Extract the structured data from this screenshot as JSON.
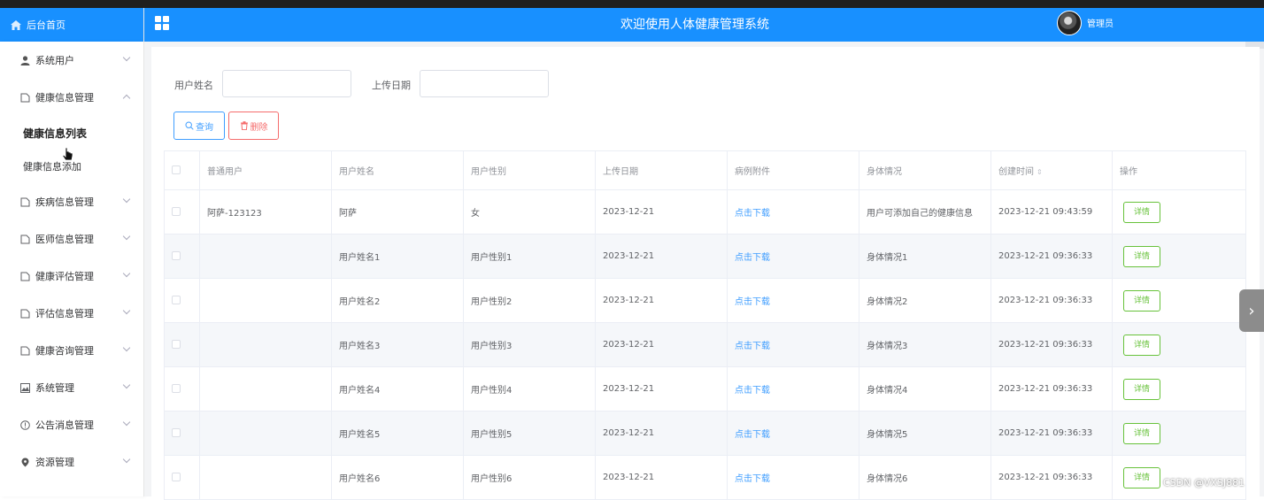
{
  "header": {
    "home_label": "后台首页",
    "title": "欢迎使用人体健康管理系统",
    "user_label": "管理员"
  },
  "sidebar": {
    "items": [
      {
        "label": "系统用户",
        "icon": "user-icon"
      },
      {
        "label": "健康信息管理",
        "icon": "document-icon",
        "expanded": true,
        "children": [
          {
            "label": "健康信息列表",
            "active": true
          },
          {
            "label": "健康信息添加"
          }
        ]
      },
      {
        "label": "疾病信息管理",
        "icon": "document-icon"
      },
      {
        "label": "医师信息管理",
        "icon": "document-icon"
      },
      {
        "label": "健康评估管理",
        "icon": "document-icon"
      },
      {
        "label": "评估信息管理",
        "icon": "document-icon"
      },
      {
        "label": "健康咨询管理",
        "icon": "document-icon"
      },
      {
        "label": "系统管理",
        "icon": "picture-icon"
      },
      {
        "label": "公告消息管理",
        "icon": "info-circle-icon"
      },
      {
        "label": "资源管理",
        "icon": "location-icon"
      }
    ]
  },
  "search": {
    "username_label": "用户姓名",
    "username_value": "",
    "date_label": "上传日期",
    "date_value": "",
    "query_button": "查询",
    "delete_button": "删除"
  },
  "table": {
    "columns": [
      "普通用户",
      "用户姓名",
      "用户性别",
      "上传日期",
      "病例附件",
      "身体情况",
      "创建时间",
      "操作"
    ],
    "rows": [
      {
        "user": "阿萨-123123",
        "name": "阿萨",
        "gender": "女",
        "date": "2023-12-21",
        "attachment": "点击下载",
        "condition": "用户可添加自己的健康信息",
        "created": "2023-12-21 09:43:59",
        "action": "详情"
      },
      {
        "user": "",
        "name": "用户姓名1",
        "gender": "用户性别1",
        "date": "2023-12-21",
        "attachment": "点击下载",
        "condition": "身体情况1",
        "created": "2023-12-21 09:36:33",
        "action": "详情"
      },
      {
        "user": "",
        "name": "用户姓名2",
        "gender": "用户性别2",
        "date": "2023-12-21",
        "attachment": "点击下载",
        "condition": "身体情况2",
        "created": "2023-12-21 09:36:33",
        "action": "详情"
      },
      {
        "user": "",
        "name": "用户姓名3",
        "gender": "用户性别3",
        "date": "2023-12-21",
        "attachment": "点击下载",
        "condition": "身体情况3",
        "created": "2023-12-21 09:36:33",
        "action": "详情"
      },
      {
        "user": "",
        "name": "用户姓名4",
        "gender": "用户性别4",
        "date": "2023-12-21",
        "attachment": "点击下载",
        "condition": "身体情况4",
        "created": "2023-12-21 09:36:33",
        "action": "详情"
      },
      {
        "user": "",
        "name": "用户姓名5",
        "gender": "用户性别5",
        "date": "2023-12-21",
        "attachment": "点击下载",
        "condition": "身体情况5",
        "created": "2023-12-21 09:36:33",
        "action": "详情"
      },
      {
        "user": "",
        "name": "用户姓名6",
        "gender": "用户性别6",
        "date": "2023-12-21",
        "attachment": "点击下载",
        "condition": "身体情况6",
        "created": "2023-12-21 09:36:33",
        "action": "详情"
      }
    ]
  },
  "watermark": "CSDN @VXSJ881",
  "colors": {
    "header": "#1890ff",
    "primary": "#409eff",
    "danger": "#f56c6c",
    "success": "#67c23a"
  }
}
